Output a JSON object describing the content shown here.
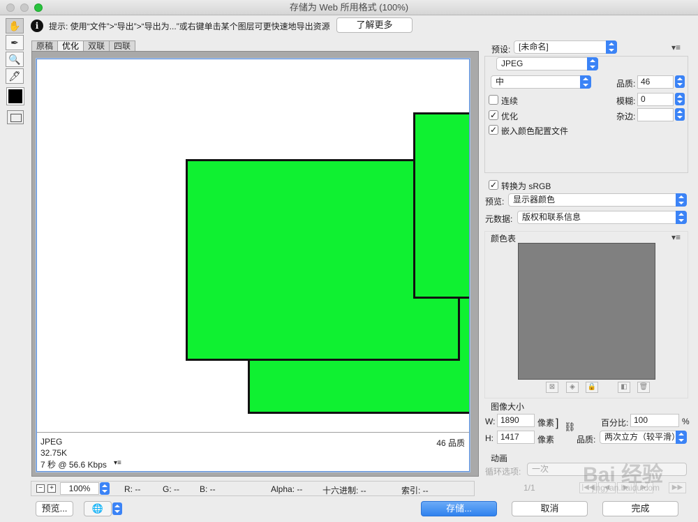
{
  "window": {
    "title": "存储为 Web 所用格式 (100%)"
  },
  "tools": [
    {
      "name": "hand-tool",
      "glyph": "✋"
    },
    {
      "name": "slice-select-tool",
      "glyph": "✒"
    },
    {
      "name": "zoom-tool",
      "glyph": "🔍"
    },
    {
      "name": "eyedropper-tool",
      "glyph": "🖊"
    }
  ],
  "hint": {
    "text": "提示: 使用“文件”>“导出”>“导出为...”或右键单击某个图层可更快速地导出资源",
    "learn_more": "了解更多"
  },
  "tabs": [
    "原稿",
    "优化",
    "双联",
    "四联"
  ],
  "active_tab": "优化",
  "image_info": {
    "format": "JPEG",
    "size": "32.75K",
    "time": "7 秒 @ 56.6 Kbps",
    "quality": "46 品质"
  },
  "bottombar": {
    "zoom": "100%",
    "r": "R: --",
    "g": "G: --",
    "b": "B: --",
    "alpha": "Alpha: --",
    "hex": "十六进制: --",
    "index": "索引: --"
  },
  "buttons": {
    "preview": "预览...",
    "save": "存储...",
    "cancel": "取消",
    "done": "完成"
  },
  "settings": {
    "preset_label": "预设:",
    "preset_value": "[未命名]",
    "format": "JPEG",
    "quality_level": "中",
    "quality_label": "品质:",
    "quality_value": "46",
    "progressive_label": "连续",
    "blur_label": "模糊:",
    "blur_value": "0",
    "optimized_label": "优化",
    "matte_label": "杂边:",
    "matte_value": "",
    "embed_profile_label": "嵌入颜色配置文件",
    "convert_srgb_label": "转换为 sRGB",
    "preview_label": "预览:",
    "preview_value": "显示器颜色",
    "metadata_label": "元数据:",
    "metadata_value": "版权和联系信息",
    "progressive_checked": false,
    "optimized_checked": true,
    "embed_checked": true,
    "srgb_checked": true
  },
  "color_table": {
    "title": "颜色表"
  },
  "image_size": {
    "title": "图像大小",
    "w_label": "W:",
    "w_value": "1890",
    "h_label": "H:",
    "h_value": "1417",
    "unit": "像素",
    "percent_label": "百分比:",
    "percent_value": "100",
    "percent_unit": "%",
    "quality_label": "品质:",
    "quality_value": "两次立方（较平滑）"
  },
  "animation": {
    "title": "动画",
    "loop_label": "循环选项:",
    "loop_value": "一次",
    "frame": "1/1"
  },
  "watermark": {
    "main": "Bai 经验",
    "sub": "jingyan.baidu.com"
  },
  "colors": {
    "accent": "#3b83f6",
    "shape_fill": "#0ff131"
  }
}
